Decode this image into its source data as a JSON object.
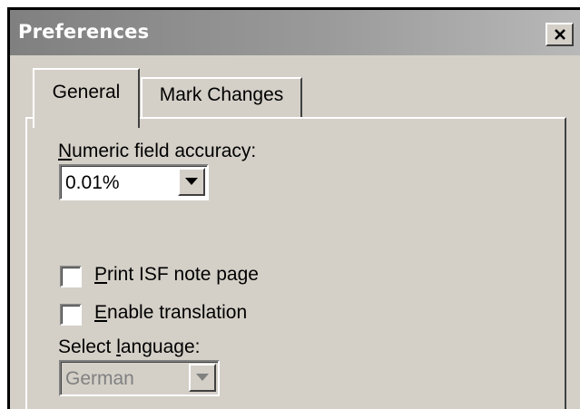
{
  "window": {
    "title": "Preferences",
    "close_glyph": "✕"
  },
  "tabs": [
    {
      "label": "General",
      "selected": true
    },
    {
      "label": "Mark Changes",
      "selected": false
    }
  ],
  "general": {
    "accuracy": {
      "label_mnemonic": "N",
      "label_rest": "umeric field accuracy:",
      "value": "0.01%"
    },
    "print_isf": {
      "label_mnemonic": "P",
      "label_rest": "rint ISF note page",
      "checked": false
    },
    "enable_translation": {
      "label_mnemonic": "E",
      "label_rest": "nable translation",
      "checked": false
    },
    "language": {
      "label_before": "Select ",
      "label_mnemonic": "l",
      "label_after": "anguage:",
      "value": "German",
      "enabled": false
    }
  },
  "icons": {
    "dropdown": "chevron-down-icon",
    "close": "close-icon"
  }
}
